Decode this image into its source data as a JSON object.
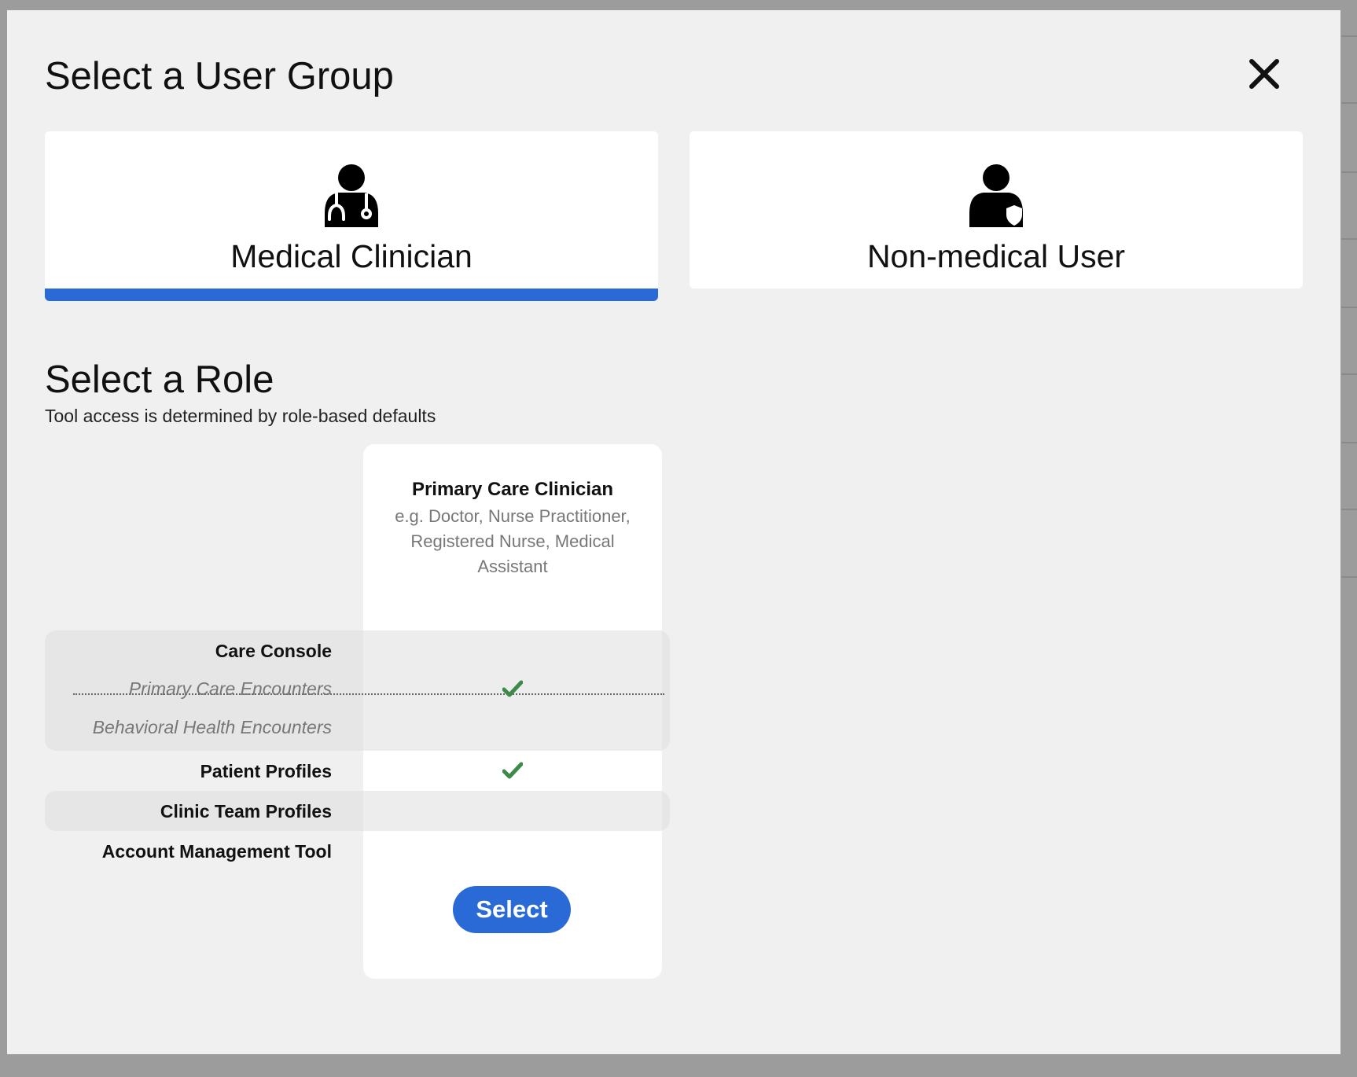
{
  "modal": {
    "title": "Select a User Group",
    "close_icon": "close-icon"
  },
  "user_groups": [
    {
      "label": "Medical Clinician",
      "icon": "doctor-stethoscope-icon",
      "selected": true
    },
    {
      "label": "Non-medical User",
      "icon": "user-shield-icon",
      "selected": false
    }
  ],
  "role_section": {
    "title": "Select a Role",
    "subtitle": "Tool access is determined by role-based defaults"
  },
  "role": {
    "name": "Primary Care Clinician",
    "description": "e.g. Doctor, Nurse Practitioner, Registered Nurse, Medical Assistant",
    "select_label": "Select"
  },
  "features": [
    {
      "label": "Care Console",
      "kind": "main",
      "enabled": false
    },
    {
      "label": "Primary Care Encounters",
      "kind": "sub",
      "enabled": true
    },
    {
      "label": "Behavioral Health Encounters",
      "kind": "sub",
      "enabled": false
    },
    {
      "label": "Patient Profiles",
      "kind": "main",
      "enabled": true
    },
    {
      "label": "Clinic Team Profiles",
      "kind": "main",
      "enabled": false
    },
    {
      "label": "Account Management Tool",
      "kind": "main",
      "enabled": false
    }
  ],
  "colors": {
    "accent": "#2a6ad6",
    "check": "#3d8a4a",
    "modal_bg": "#f0f0f0"
  }
}
